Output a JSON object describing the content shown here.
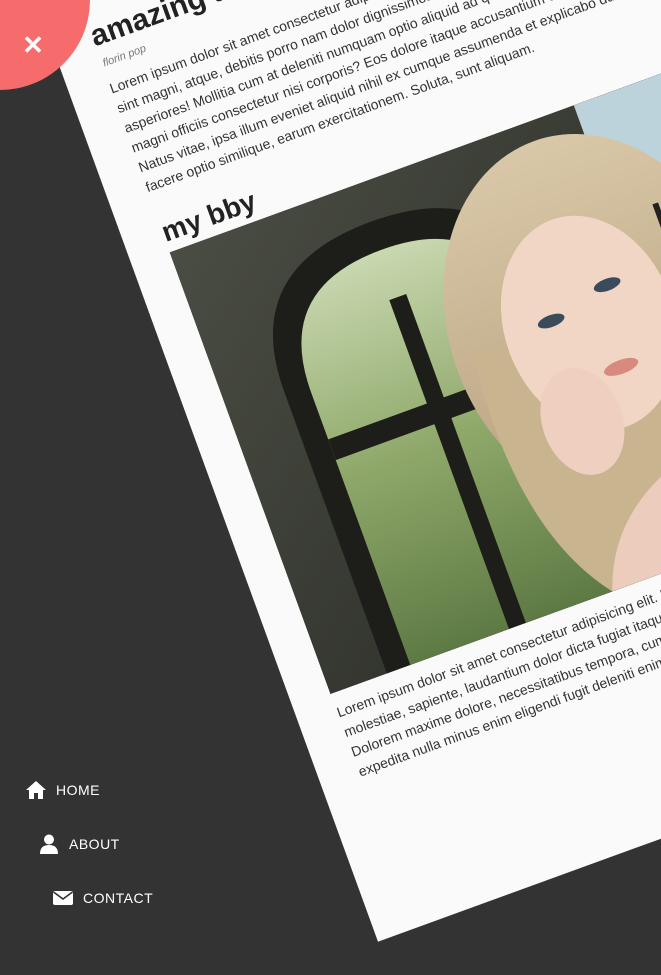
{
  "article": {
    "title": "amazing article",
    "author": "florin pop",
    "intro": "Lorem ipsum dolor sit amet consectetur adipisicing elit. Nam, tempora praesentium ipsa sint magni, atque, debitis porro nam dolor dignissimos sunt? Quaerat praesentium asperiores! Mollitia cum at deleniti numquam optio aliquid ad quibusdam obcaecati nulla magni officiis consectetur nisi corporis? Eos dolore itaque accusantium omnis unde dolor. Natus vitae, ipsa illum eveniet aliquid nihil ex cumque assumenda et explicabo ducimus facere optio similique, earum exercitationem. Soluta, sunt aliquam.",
    "subtitle": "my bby",
    "body": "Lorem ipsum dolor sit amet consectetur adipisicing elit. Iure alias dolorum veritatis aliquid molestiae, sapiente, laudantium dolor dicta fugiat itaque deserunt error, doloremque. Dolorem maxime dolore, necessitatibus tempora, cum labore eius ad dignissimos expedita nulla minus enim eligendi fugit deleniti enim natus dicta."
  },
  "close_button": {
    "symbol": "✕",
    "icon": "close-icon",
    "color": "#f66b6b"
  },
  "nav": {
    "items": [
      {
        "label": "HOME",
        "icon": "home-icon"
      },
      {
        "label": "ABOUT",
        "icon": "user-icon"
      },
      {
        "label": "CONTACT",
        "icon": "envelope-icon"
      }
    ]
  },
  "colors": {
    "background": "#333333",
    "card": "#fafafa",
    "accent": "#f66b6b"
  }
}
